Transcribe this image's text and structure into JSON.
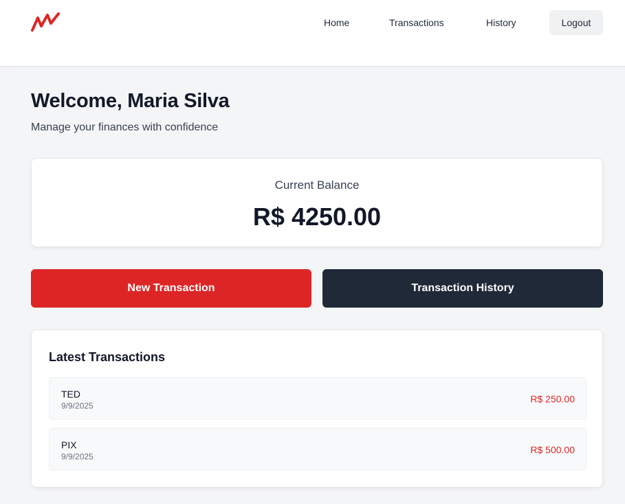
{
  "nav": {
    "logo_icon": "zigzag-logo-icon",
    "home_label": "Home",
    "transactions_label": "Transactions",
    "history_label": "History",
    "logout_label": "Logout"
  },
  "header": {
    "title": "Welcome, Maria Silva",
    "subtitle": "Manage your finances with confidence"
  },
  "balance": {
    "label": "Current Balance",
    "value": "R$ 4250.00"
  },
  "actions": {
    "new_transaction_label": "New Transaction",
    "transaction_history_label": "Transaction History"
  },
  "latest": {
    "title": "Latest Transactions",
    "items": [
      {
        "type": "TED",
        "date": "9/9/2025",
        "amount": "R$ 250.00"
      },
      {
        "type": "PIX",
        "date": "9/9/2025",
        "amount": "R$ 500.00"
      }
    ]
  },
  "colors": {
    "brand_red": "#dc2626",
    "dark_button": "#1f2937",
    "background": "#f4f5f7"
  }
}
